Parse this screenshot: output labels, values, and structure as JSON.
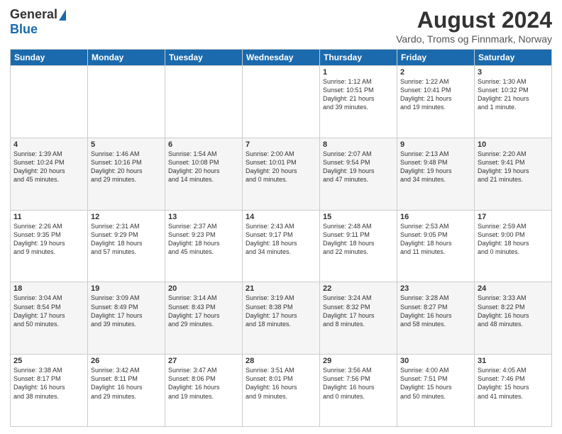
{
  "logo": {
    "general": "General",
    "blue": "Blue"
  },
  "title": "August 2024",
  "subtitle": "Vardo, Troms og Finnmark, Norway",
  "headers": [
    "Sunday",
    "Monday",
    "Tuesday",
    "Wednesday",
    "Thursday",
    "Friday",
    "Saturday"
  ],
  "weeks": [
    [
      {
        "day": "",
        "info": ""
      },
      {
        "day": "",
        "info": ""
      },
      {
        "day": "",
        "info": ""
      },
      {
        "day": "",
        "info": ""
      },
      {
        "day": "1",
        "info": "Sunrise: 1:12 AM\nSunset: 10:51 PM\nDaylight: 21 hours\nand 39 minutes."
      },
      {
        "day": "2",
        "info": "Sunrise: 1:22 AM\nSunset: 10:41 PM\nDaylight: 21 hours\nand 19 minutes."
      },
      {
        "day": "3",
        "info": "Sunrise: 1:30 AM\nSunset: 10:32 PM\nDaylight: 21 hours\nand 1 minute."
      }
    ],
    [
      {
        "day": "4",
        "info": "Sunrise: 1:39 AM\nSunset: 10:24 PM\nDaylight: 20 hours\nand 45 minutes."
      },
      {
        "day": "5",
        "info": "Sunrise: 1:46 AM\nSunset: 10:16 PM\nDaylight: 20 hours\nand 29 minutes."
      },
      {
        "day": "6",
        "info": "Sunrise: 1:54 AM\nSunset: 10:08 PM\nDaylight: 20 hours\nand 14 minutes."
      },
      {
        "day": "7",
        "info": "Sunrise: 2:00 AM\nSunset: 10:01 PM\nDaylight: 20 hours\nand 0 minutes."
      },
      {
        "day": "8",
        "info": "Sunrise: 2:07 AM\nSunset: 9:54 PM\nDaylight: 19 hours\nand 47 minutes."
      },
      {
        "day": "9",
        "info": "Sunrise: 2:13 AM\nSunset: 9:48 PM\nDaylight: 19 hours\nand 34 minutes."
      },
      {
        "day": "10",
        "info": "Sunrise: 2:20 AM\nSunset: 9:41 PM\nDaylight: 19 hours\nand 21 minutes."
      }
    ],
    [
      {
        "day": "11",
        "info": "Sunrise: 2:26 AM\nSunset: 9:35 PM\nDaylight: 19 hours\nand 9 minutes."
      },
      {
        "day": "12",
        "info": "Sunrise: 2:31 AM\nSunset: 9:29 PM\nDaylight: 18 hours\nand 57 minutes."
      },
      {
        "day": "13",
        "info": "Sunrise: 2:37 AM\nSunset: 9:23 PM\nDaylight: 18 hours\nand 45 minutes."
      },
      {
        "day": "14",
        "info": "Sunrise: 2:43 AM\nSunset: 9:17 PM\nDaylight: 18 hours\nand 34 minutes."
      },
      {
        "day": "15",
        "info": "Sunrise: 2:48 AM\nSunset: 9:11 PM\nDaylight: 18 hours\nand 22 minutes."
      },
      {
        "day": "16",
        "info": "Sunrise: 2:53 AM\nSunset: 9:05 PM\nDaylight: 18 hours\nand 11 minutes."
      },
      {
        "day": "17",
        "info": "Sunrise: 2:59 AM\nSunset: 9:00 PM\nDaylight: 18 hours\nand 0 minutes."
      }
    ],
    [
      {
        "day": "18",
        "info": "Sunrise: 3:04 AM\nSunset: 8:54 PM\nDaylight: 17 hours\nand 50 minutes."
      },
      {
        "day": "19",
        "info": "Sunrise: 3:09 AM\nSunset: 8:49 PM\nDaylight: 17 hours\nand 39 minutes."
      },
      {
        "day": "20",
        "info": "Sunrise: 3:14 AM\nSunset: 8:43 PM\nDaylight: 17 hours\nand 29 minutes."
      },
      {
        "day": "21",
        "info": "Sunrise: 3:19 AM\nSunset: 8:38 PM\nDaylight: 17 hours\nand 18 minutes."
      },
      {
        "day": "22",
        "info": "Sunrise: 3:24 AM\nSunset: 8:32 PM\nDaylight: 17 hours\nand 8 minutes."
      },
      {
        "day": "23",
        "info": "Sunrise: 3:28 AM\nSunset: 8:27 PM\nDaylight: 16 hours\nand 58 minutes."
      },
      {
        "day": "24",
        "info": "Sunrise: 3:33 AM\nSunset: 8:22 PM\nDaylight: 16 hours\nand 48 minutes."
      }
    ],
    [
      {
        "day": "25",
        "info": "Sunrise: 3:38 AM\nSunset: 8:17 PM\nDaylight: 16 hours\nand 38 minutes."
      },
      {
        "day": "26",
        "info": "Sunrise: 3:42 AM\nSunset: 8:11 PM\nDaylight: 16 hours\nand 29 minutes."
      },
      {
        "day": "27",
        "info": "Sunrise: 3:47 AM\nSunset: 8:06 PM\nDaylight: 16 hours\nand 19 minutes."
      },
      {
        "day": "28",
        "info": "Sunrise: 3:51 AM\nSunset: 8:01 PM\nDaylight: 16 hours\nand 9 minutes."
      },
      {
        "day": "29",
        "info": "Sunrise: 3:56 AM\nSunset: 7:56 PM\nDaylight: 16 hours\nand 0 minutes."
      },
      {
        "day": "30",
        "info": "Sunrise: 4:00 AM\nSunset: 7:51 PM\nDaylight: 15 hours\nand 50 minutes."
      },
      {
        "day": "31",
        "info": "Sunrise: 4:05 AM\nSunset: 7:46 PM\nDaylight: 15 hours\nand 41 minutes."
      }
    ]
  ]
}
